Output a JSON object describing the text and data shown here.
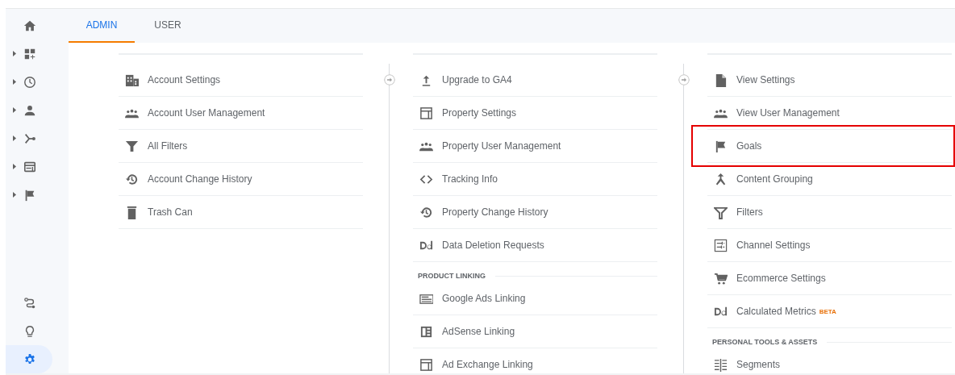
{
  "sidebar": {
    "items": [
      {
        "expandable": false,
        "selected": false
      },
      {
        "expandable": true,
        "selected": false
      },
      {
        "expandable": true,
        "selected": false
      },
      {
        "expandable": true,
        "selected": false
      },
      {
        "expandable": true,
        "selected": false
      },
      {
        "expandable": true,
        "selected": false
      },
      {
        "expandable": true,
        "selected": false
      }
    ],
    "bottom_items": [
      {
        "selected": false
      },
      {
        "selected": false
      },
      {
        "selected": true
      }
    ]
  },
  "tabs": [
    {
      "label": "ADMIN",
      "selected": true
    },
    {
      "label": "USER",
      "selected": false
    }
  ],
  "columns": [
    {
      "items": [
        {
          "kind": "link",
          "label": "Account Settings",
          "highlighted": false
        },
        {
          "kind": "link",
          "label": "Account User Management",
          "highlighted": false
        },
        {
          "kind": "link",
          "label": "All Filters",
          "highlighted": false
        },
        {
          "kind": "link",
          "label": "Account Change History",
          "highlighted": false
        },
        {
          "kind": "link",
          "label": "Trash Can",
          "highlighted": false
        }
      ]
    },
    {
      "items": [
        {
          "kind": "link",
          "label": "Upgrade to GA4",
          "highlighted": false
        },
        {
          "kind": "link",
          "label": "Property Settings",
          "highlighted": false
        },
        {
          "kind": "link",
          "label": "Property User Management",
          "highlighted": false
        },
        {
          "kind": "link",
          "label": "Tracking Info",
          "highlighted": false
        },
        {
          "kind": "link",
          "label": "Property Change History",
          "highlighted": false
        },
        {
          "kind": "link",
          "label": "Data Deletion Requests",
          "highlighted": false
        },
        {
          "kind": "heading",
          "label": "PRODUCT LINKING"
        },
        {
          "kind": "link",
          "label": "Google Ads Linking",
          "highlighted": false
        },
        {
          "kind": "link",
          "label": "AdSense Linking",
          "highlighted": false
        },
        {
          "kind": "link",
          "label": "Ad Exchange Linking",
          "highlighted": false
        }
      ]
    },
    {
      "items": [
        {
          "kind": "link",
          "label": "View Settings",
          "highlighted": false
        },
        {
          "kind": "link",
          "label": "View User Management",
          "highlighted": false
        },
        {
          "kind": "link",
          "label": "Goals",
          "highlighted": true
        },
        {
          "kind": "link",
          "label": "Content Grouping",
          "highlighted": false
        },
        {
          "kind": "link",
          "label": "Filters",
          "highlighted": false
        },
        {
          "kind": "link",
          "label": "Channel Settings",
          "highlighted": false
        },
        {
          "kind": "link",
          "label": "Ecommerce Settings",
          "highlighted": false
        },
        {
          "kind": "link",
          "label": "Calculated Metrics",
          "badge": "BETA",
          "highlighted": false
        },
        {
          "kind": "heading",
          "label": "PERSONAL TOOLS & ASSETS"
        },
        {
          "kind": "link",
          "label": "Segments",
          "highlighted": false
        }
      ]
    }
  ]
}
